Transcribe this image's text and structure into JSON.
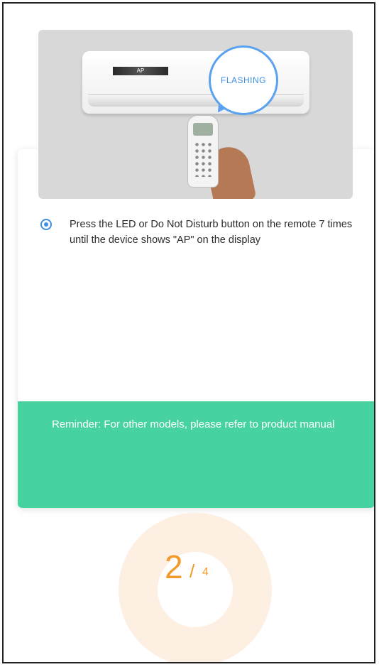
{
  "illustration": {
    "bubble_label": "FLASHING",
    "display_label": "AP",
    "bubble_color": "#5aa2ef"
  },
  "instruction": {
    "text": "Press the LED or Do Not Disturb button on the remote 7 times until the device shows \"AP\" on the display",
    "selected": true
  },
  "reminder": {
    "text": "Reminder: For other models, please refer to product manual",
    "color": "#47d39f"
  },
  "progress": {
    "current": "2",
    "separator": "/",
    "total": "4",
    "color": "#f39a2d"
  }
}
